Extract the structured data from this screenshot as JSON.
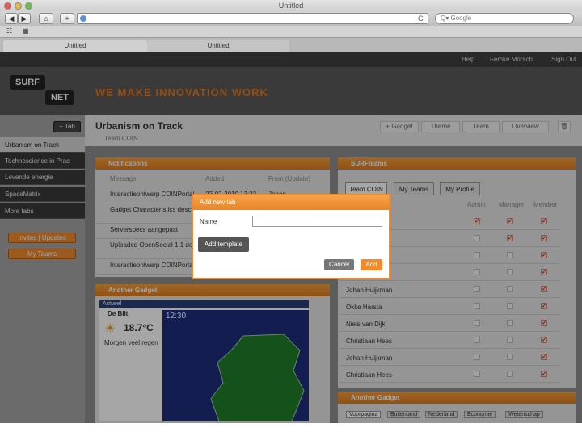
{
  "window": {
    "title": "Untitled"
  },
  "toolbar": {
    "back": "◀",
    "forward": "▶",
    "home": "⌂",
    "add": "+",
    "reload": "C",
    "search_placeholder": "Q▾ Google"
  },
  "bookmarks": {
    "reader": "☷",
    "grid": "▦"
  },
  "tabs": [
    {
      "label": "Untitled"
    },
    {
      "label": "Untitled"
    }
  ],
  "topnav": {
    "help": "Help",
    "user": "Femke Morsch",
    "signout": "Sign Out"
  },
  "logo": {
    "line1": "SURF",
    "line2": "NET"
  },
  "tagline": "WE MAKE INNOVATION WORK",
  "sidebar": {
    "add_tab": "+ Tab",
    "items": [
      "Urbanism on Track",
      "Technoscience in Prac",
      "Levende energie",
      "SpaceMatrix",
      "More tabs"
    ],
    "invites": "Invites | Updates",
    "myteams": "My Teams"
  },
  "page": {
    "title": "Urbanism on Track",
    "team": "Team COIN",
    "actions": [
      "+ Gadget",
      "Theme",
      "Team",
      "Overview"
    ]
  },
  "notifications": {
    "title": "Notifications",
    "headers": [
      "Message",
      "Added",
      "From (Update)"
    ],
    "rows": [
      {
        "msg": "Interactieontwerp COINPortal",
        "added": "22-02-2010 13:33",
        "from": "Johan"
      },
      {
        "msg": "Gadget Characteristics described in Confluence Wiki",
        "added": "",
        "from": ""
      },
      {
        "msg": "Serverspecs aangepast",
        "added": "",
        "from": ""
      },
      {
        "msg": "Uploaded OpenSocial 1.1 documentation",
        "added": "",
        "from": ""
      },
      {
        "msg": "Interactieontwerp COINPortal",
        "added": "",
        "from": ""
      }
    ]
  },
  "surfteams": {
    "title": "SURFteams",
    "tabs": [
      "Team COIN",
      "My Teams",
      "My Profile"
    ],
    "headers": [
      "Admin",
      "Manager",
      "Member"
    ],
    "members": [
      {
        "name": "",
        "admin": true,
        "manager": true,
        "member": true
      },
      {
        "name": "",
        "admin": false,
        "manager": true,
        "member": true
      },
      {
        "name": "",
        "admin": false,
        "manager": false,
        "member": true
      },
      {
        "name": "",
        "admin": false,
        "manager": false,
        "member": true
      },
      {
        "name": "Johan Huijkman",
        "admin": false,
        "manager": false,
        "member": true
      },
      {
        "name": "Okke Harsta",
        "admin": false,
        "manager": false,
        "member": true
      },
      {
        "name": "Niels van Dijk",
        "admin": false,
        "manager": false,
        "member": true
      },
      {
        "name": "Christiaan Hees",
        "admin": false,
        "manager": false,
        "member": true
      },
      {
        "name": "Johan Huijkman",
        "admin": false,
        "manager": false,
        "member": true
      },
      {
        "name": "Christiaan Hees",
        "admin": false,
        "manager": false,
        "member": true
      }
    ]
  },
  "another_gadget": {
    "title": "Another Gadget",
    "actueel": "Actueel",
    "place": "De Bilt",
    "temp": "18.7°C",
    "forecast": "Morgen veel regen",
    "time": "12:30"
  },
  "another_gadget2": {
    "title": "Another Gadget",
    "tabs": [
      "Voorpagina",
      "Buitenland",
      "Nederland",
      "Economie",
      "Wetenschap"
    ]
  },
  "dialog": {
    "title": "Add new tab",
    "name_label": "Name",
    "name_value": "",
    "add_template": "Add template",
    "cancel": "Cancel",
    "add": "Add"
  }
}
